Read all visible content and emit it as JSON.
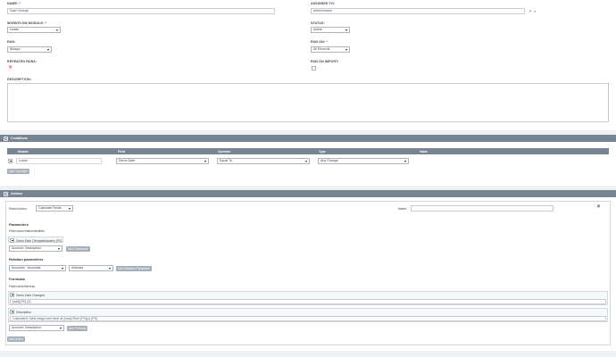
{
  "form": {
    "name_label": "NAME:",
    "name_required": "*",
    "name_value": "Date Change",
    "assigned_label": "ASSIGNED TO:",
    "assigned_value": "Administrator",
    "module_label": "WORKFLOW MODULE:",
    "module_required": "*",
    "module_value": "Leads",
    "status_label": "STATUS:",
    "status_value": "Active",
    "run_label": "RUN:",
    "run_value": "Always",
    "runon_label": "RUN ON:",
    "runon_required": "*",
    "runon_value": "All Records",
    "repeated_label": "REPEATED RUNS:",
    "runonimport_label": "RUN ON IMPORT:",
    "description_label": "DESCRIPTION:",
    "description_value": ""
  },
  "conditions": {
    "title": "Conditions",
    "headers": [
      "Module",
      "Field",
      "Operator",
      "Type",
      "Value"
    ],
    "row": {
      "module": "Leads",
      "field": "Demo Date",
      "operator": "Equal To",
      "type": "Any Change"
    },
    "add_button": "Add Condition"
  },
  "actions": {
    "title": "Actions",
    "select_action_label": "Select Action:",
    "select_action_value": "Calculate Fields",
    "name_label": "Name:",
    "name_value": "",
    "parameters_title": "Parameters",
    "field_name_header": "Field name/Value/identifier",
    "param_item": "Demo Date (TemplateAware) {P0}",
    "param_select": "Account: Description",
    "add_parameter": "Add Parameter",
    "relation_title": "Relation parameters",
    "relation_select1": "Accounts : Accounts",
    "relation_select2": "Address",
    "add_relation": "Add Relation Parameter",
    "formulas_title": "Formulas",
    "field_formula_header": "Field name/formula",
    "formula1_name": "Demo Date Changed",
    "formula1_value": "{add}{P0} {2}",
    "formula2_name": "Description",
    "formula2_value": "Calculated: Next mega here time at {now}/Time {P0}(x) {P0}",
    "formula_select": "Account: Description",
    "add_formula": "Add Formula",
    "add_action": "Add Action"
  },
  "colors": {
    "section_bar": "#778592",
    "button": "#a5b0ba",
    "background": "#f0f1f3"
  },
  "icons": {
    "clear": "x-icon",
    "select": "arrow-icon",
    "close": "close-icon"
  }
}
